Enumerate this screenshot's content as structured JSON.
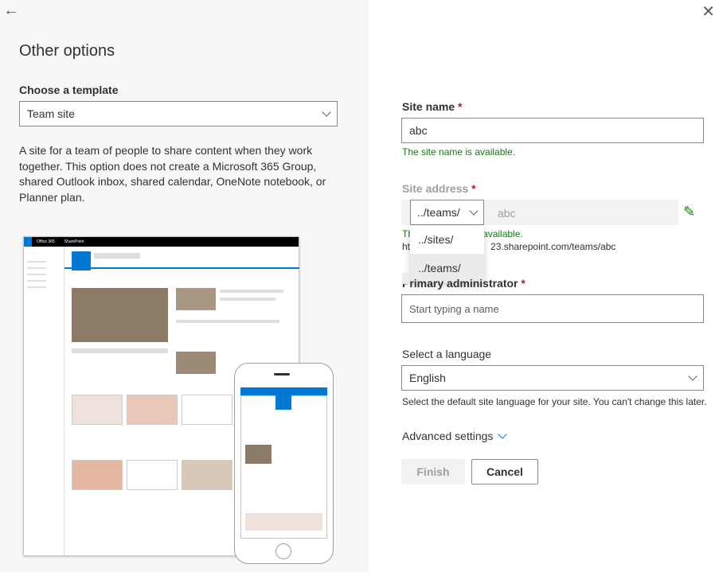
{
  "nav": {
    "back_icon": "arrow-left-icon",
    "close_icon": "close-icon"
  },
  "left": {
    "title": "Other options",
    "template_label": "Choose a template",
    "template_value": "Team site",
    "description": "A site for a team of people to share content when they work together. This option does not create a Microsoft 365 Group, shared Outlook inbox, shared calendar, OneNote notebook, or Planner plan.",
    "preview": {
      "brand": "Office 365",
      "app": "SharePoint",
      "accent": "#0078d4"
    }
  },
  "form": {
    "site_name_label": "Site name",
    "site_name_value": "abc",
    "site_name_status": "The site name is available.",
    "site_address_label": "Site address",
    "address_prefix": "../teams/",
    "address_value": "abc",
    "address_status_start": "Th",
    "address_status_end": "available.",
    "address_url_start": "ht",
    "address_url_end": "23.sharepoint.com/teams/abc",
    "prefix_options": [
      "../sites/",
      "../teams/"
    ],
    "admin_label": "Primary administrator",
    "admin_placeholder": "Start typing a name",
    "language_label": "Select a language",
    "language_value": "English",
    "language_help": "Select the default site language for your site. You can't change this later.",
    "advanced_label": "Advanced settings",
    "finish_label": "Finish",
    "cancel_label": "Cancel",
    "required_mark": "*"
  }
}
